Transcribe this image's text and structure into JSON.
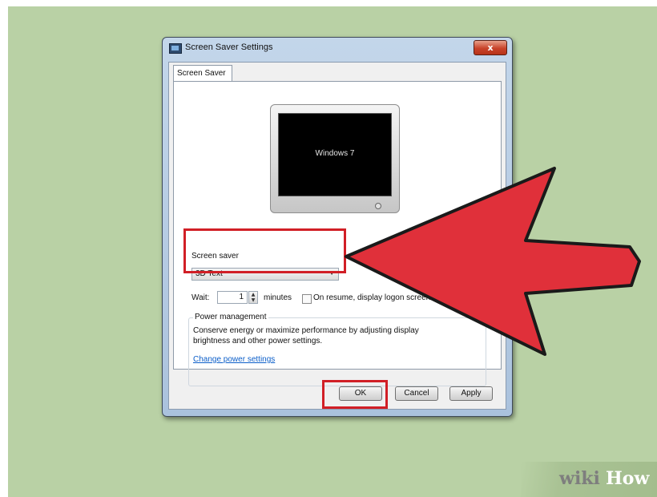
{
  "window": {
    "title": "Screen Saver Settings",
    "close_label": "x",
    "tab_label": "Screen Saver"
  },
  "preview": {
    "screen_text": "Windows 7"
  },
  "screen_saver": {
    "group_label": "Screen saver",
    "selected": "3D Text",
    "wait_label": "Wait:",
    "wait_value": "1",
    "minutes_label": "minutes",
    "resume_checked": false,
    "resume_label": "On resume, display logon screen"
  },
  "power": {
    "group_label": "Power management",
    "description": "Conserve energy or maximize performance by adjusting display brightness and other power settings.",
    "link": "Change power settings"
  },
  "buttons": {
    "ok": "OK",
    "cancel": "Cancel",
    "apply": "Apply"
  },
  "annotations": {
    "highlight_color": "#d11f26",
    "arrow_color": "#e0303a",
    "background_color": "#b9d1a5"
  },
  "watermark": {
    "part1": "wiki",
    "part2": "How"
  }
}
